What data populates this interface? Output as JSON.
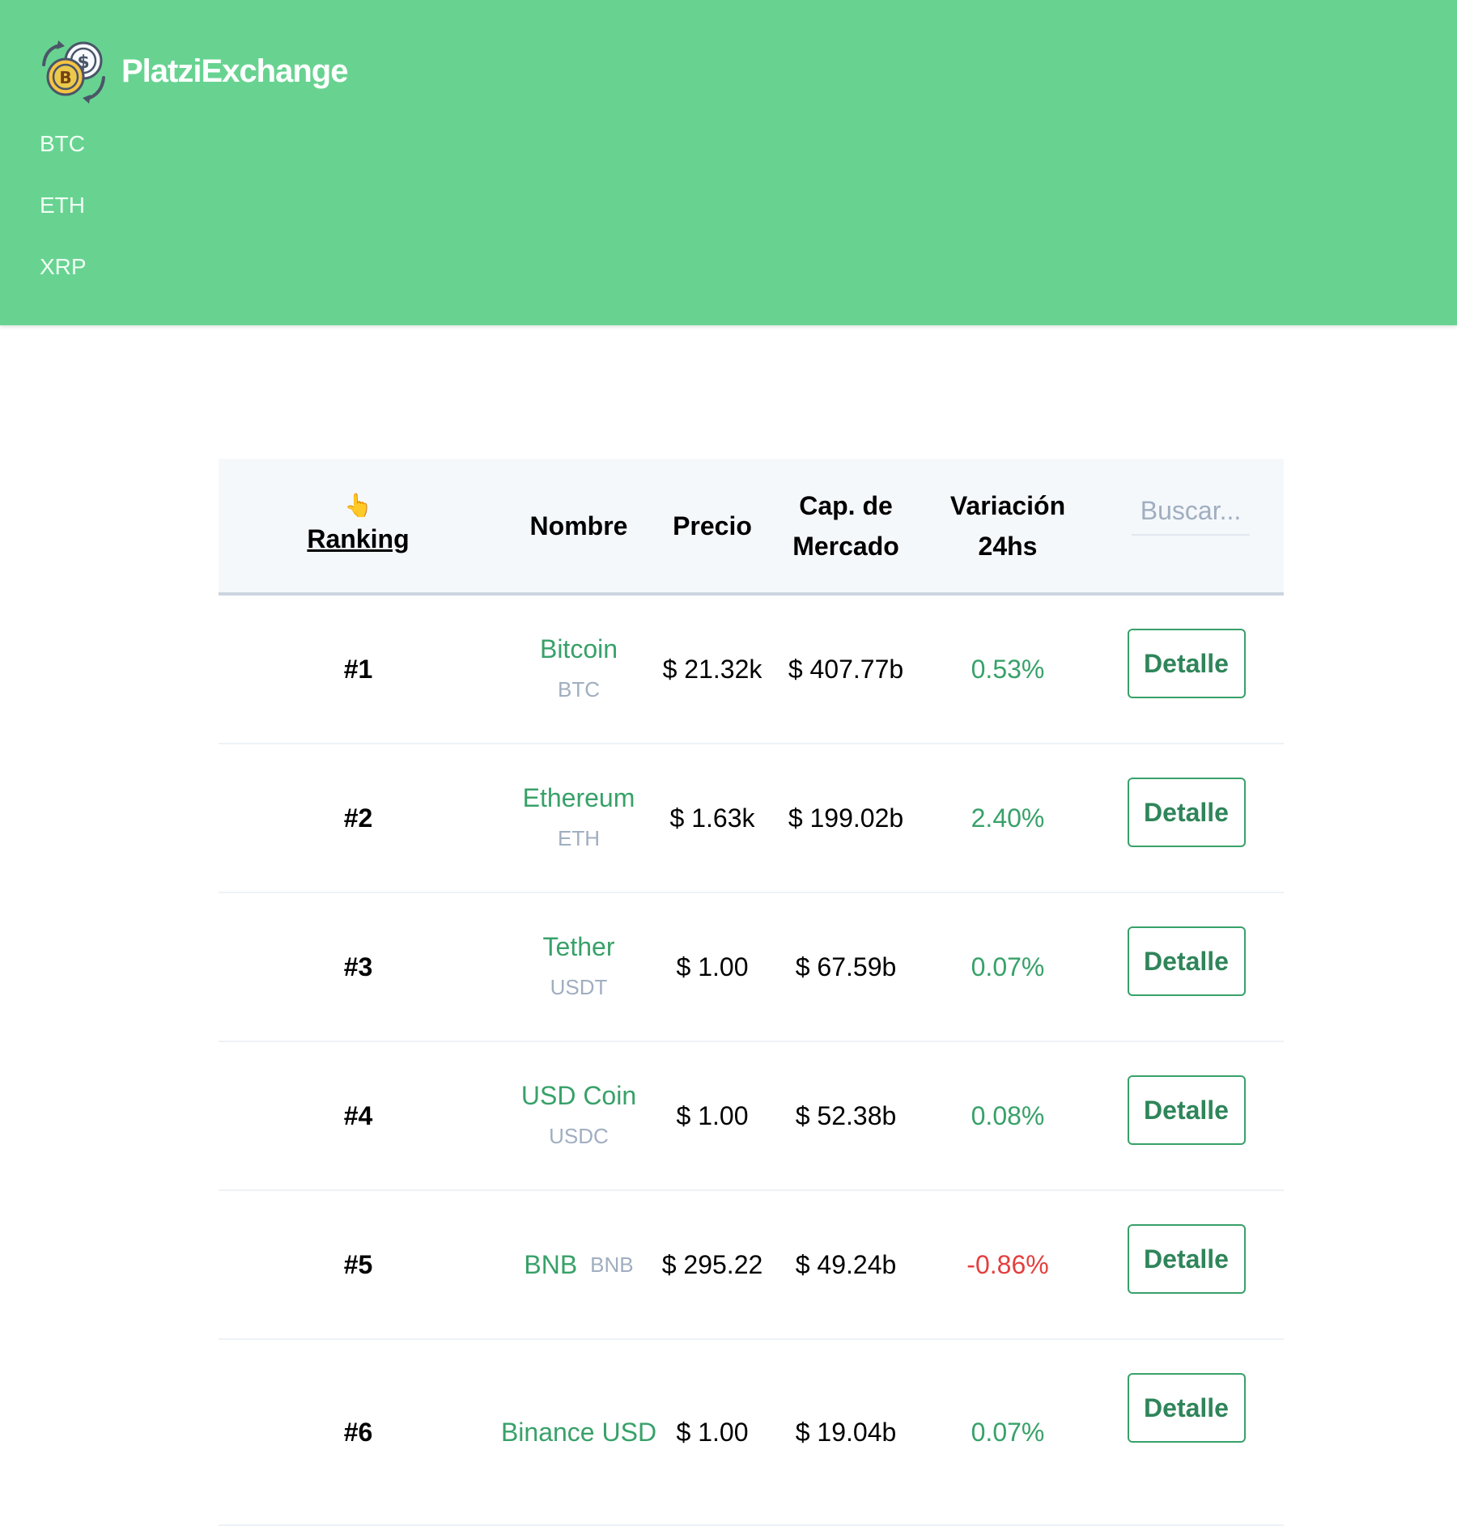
{
  "header": {
    "brand_title": "PlatziExchange",
    "logo_icon": "coin-exchange-icon",
    "brand_color": "#68d391",
    "nav_links": [
      "BTC",
      "ETH",
      "XRP"
    ]
  },
  "table": {
    "columns": {
      "ranking_emoji": "👆",
      "ranking": "Ranking",
      "name": "Nombre",
      "price": "Precio",
      "market_cap_line1": "Cap. de",
      "market_cap_line2": "Mercado",
      "variation_line1": "Variación",
      "variation_line2": "24hs"
    },
    "search_placeholder": "Buscar...",
    "detail_label": "Detalle",
    "rows": [
      {
        "rank": "#1",
        "name": "Bitcoin",
        "symbol": "BTC",
        "price": "$ 21.32k",
        "market_cap": "$ 407.77b",
        "variation": "0.53%"
      },
      {
        "rank": "#2",
        "name": "Ethereum",
        "symbol": "ETH",
        "price": "$ 1.63k",
        "market_cap": "$ 199.02b",
        "variation": "2.40%"
      },
      {
        "rank": "#3",
        "name": "Tether",
        "symbol": "USDT",
        "price": "$ 1.00",
        "market_cap": "$ 67.59b",
        "variation": "0.07%"
      },
      {
        "rank": "#4",
        "name": "USD Coin",
        "symbol": "USDC",
        "price": "$ 1.00",
        "market_cap": "$ 52.38b",
        "variation": "0.08%"
      },
      {
        "rank": "#5",
        "name": "BNB",
        "symbol": "BNB",
        "price": "$ 295.22",
        "market_cap": "$ 49.24b",
        "variation": "-0.86%"
      },
      {
        "rank": "#6",
        "name": "Binance USD",
        "symbol": "",
        "price": "$ 1.00",
        "market_cap": "$ 19.04b",
        "variation": "0.07%"
      }
    ]
  },
  "colors": {
    "positive": "#38a169",
    "negative": "#e53e3e",
    "symbol": "#a0aec0"
  }
}
